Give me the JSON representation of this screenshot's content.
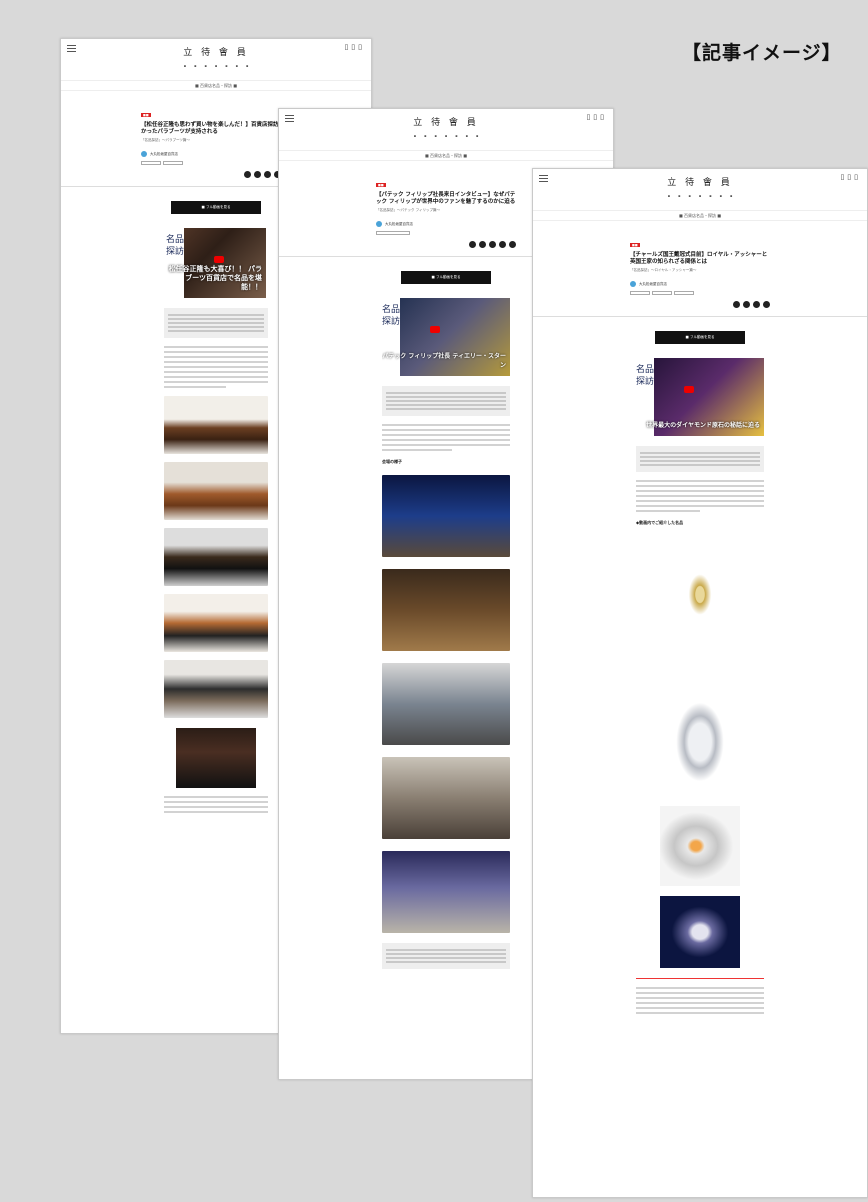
{
  "corner_label": "【記事イメージ】",
  "pages": [
    {
      "logo": "立 待 會 員",
      "logo_sub": "",
      "breadcrumb": "■ 百貨店名品・探訪 ■",
      "title": "【松任谷正隆も思わず買い物を楽しんだ！】百貨店探訪でわかったパラブーツが支持される",
      "subtitle": "「名品探訪」〜パラブーツ篇〜",
      "author": "大丸松坂屋百貨店",
      "hero_kanji": "名品探訪",
      "hero_caption": "松任谷正隆も大喜び！！ パラブーツ百貨店で名品を堪能！！",
      "button": "■ フル動画を見る"
    },
    {
      "logo": "立 待 會 員",
      "breadcrumb": "■ 百貨店名品・探訪 ■",
      "title": "【パテック フィリップ社長来日インタビュー】なぜパテック フィリップが世界中のファンを魅了するのかに迫る",
      "subtitle": "「名品探訪」〜パテック フィリップ篇〜",
      "author": "大丸松坂屋百貨店",
      "hero_kanji": "名品探訪",
      "hero_caption": "パテック フィリップ社長 ティエリー・スターン",
      "section": "会場の様子",
      "button": "■ フル動画を見る"
    },
    {
      "logo": "立 待 會 員",
      "breadcrumb": "■ 百貨店名品・探訪 ■",
      "title": "【チャールズ国王戴冠式目前】ロイヤル・アッシャーと英国王家の知られざる関係とは",
      "subtitle": "「名品探訪」〜ロイヤル・アッシャー篇〜",
      "author": "大丸松坂屋百貨店",
      "hero_kanji": "名品探訪",
      "hero_caption": "世界最大のダイヤモンド原石の秘話に迫る",
      "section": "◆動画内でご紹介した名品",
      "button": "■ フル動画を見る"
    }
  ]
}
